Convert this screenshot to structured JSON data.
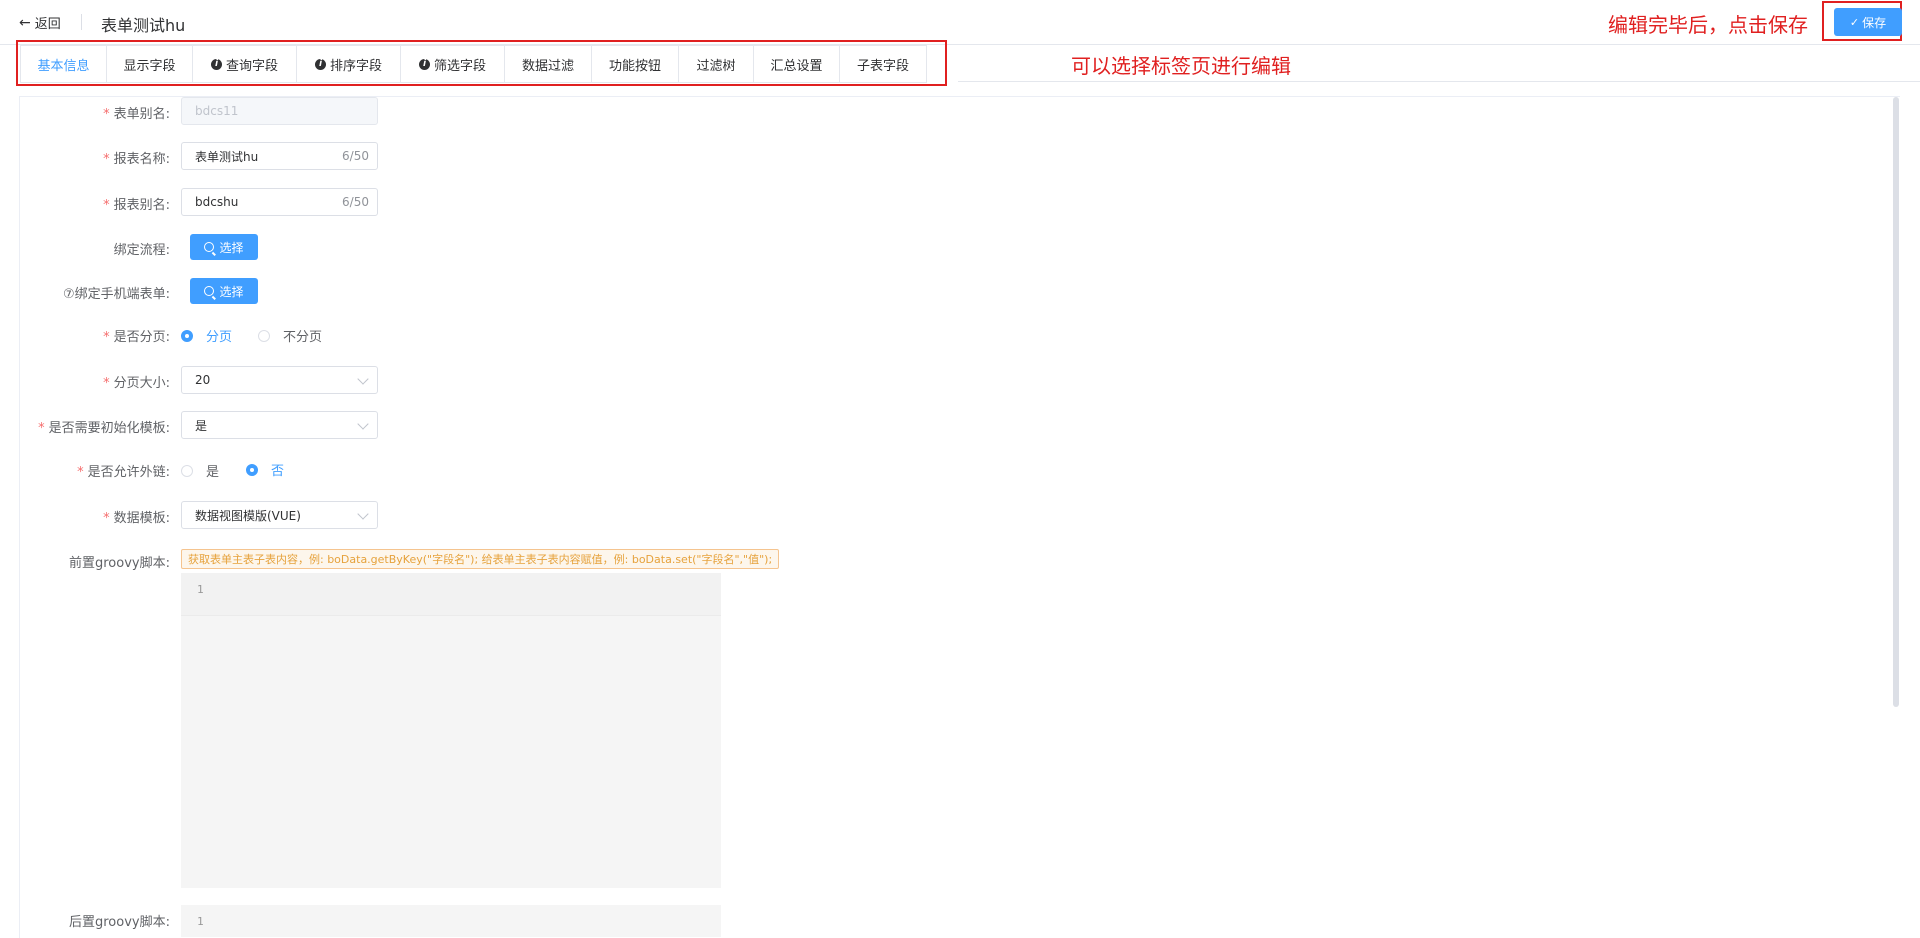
{
  "header": {
    "back_label": "返回",
    "title": "表单测试hu",
    "save_label": "保存",
    "annotation_save": "编辑完毕后，点击保存"
  },
  "tabs": {
    "annotation": "可以选择标签页进行编辑",
    "items": [
      {
        "label": "基本信息",
        "active": true,
        "info": false
      },
      {
        "label": "显示字段",
        "active": false,
        "info": false
      },
      {
        "label": "查询字段",
        "active": false,
        "info": true
      },
      {
        "label": "排序字段",
        "active": false,
        "info": true
      },
      {
        "label": "筛选字段",
        "active": false,
        "info": true
      },
      {
        "label": "数据过滤",
        "active": false,
        "info": false
      },
      {
        "label": "功能按钮",
        "active": false,
        "info": false
      },
      {
        "label": "过滤树",
        "active": false,
        "info": false
      },
      {
        "label": "汇总设置",
        "active": false,
        "info": false
      },
      {
        "label": "子表字段",
        "active": false,
        "info": false
      }
    ]
  },
  "form": {
    "form_alias": {
      "label": "表单别名:",
      "value": "bdcs11"
    },
    "report_name": {
      "label": "报表名称:",
      "value": "表单测试hu",
      "count": "6/50"
    },
    "report_alias": {
      "label": "报表别名:",
      "value": "bdcshu",
      "count": "6/50"
    },
    "bind_flow": {
      "label": "绑定流程:",
      "button": "选择"
    },
    "bind_mobile": {
      "label": "⑦绑定手机端表单:",
      "button": "选择"
    },
    "paging": {
      "label": "是否分页:",
      "options": [
        "分页",
        "不分页"
      ],
      "selected": "分页"
    },
    "page_size": {
      "label": "分页大小:",
      "value": "20"
    },
    "init_template": {
      "label": "是否需要初始化模板:",
      "value": "是"
    },
    "allow_external": {
      "label": "是否允许外链:",
      "options": [
        "是",
        "否"
      ],
      "selected": "否"
    },
    "data_template": {
      "label": "数据模板:",
      "value": "数据视图模版(VUE)"
    },
    "pre_script": {
      "label": "前置groovy脚本:",
      "hint": "获取表单主表子表内容，例: boData.getByKey(\"字段名\"); 给表单主表子表内容赋值，例: boData.set(\"字段名\",\"值\");",
      "line_number": "1"
    },
    "post_script": {
      "label": "后置groovy脚本:",
      "line_number": "1"
    }
  },
  "colors": {
    "primary": "#409eff",
    "annotation_red": "#e02020",
    "required": "#f56c6c",
    "hint_orange": "#e6a23c"
  }
}
